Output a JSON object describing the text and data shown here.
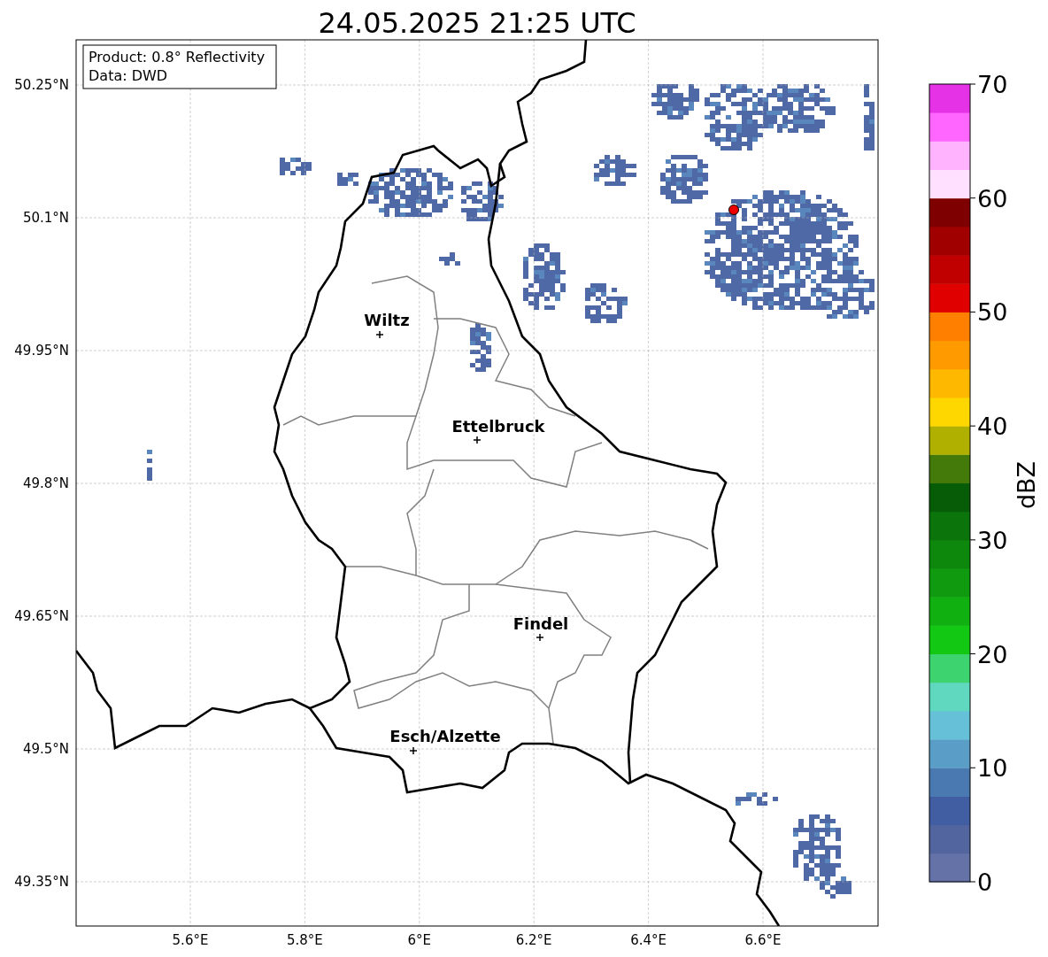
{
  "title": "24.05.2025 21:25 UTC",
  "info_box": [
    "Product: 0.8° Reflectivity",
    "Data: DWD"
  ],
  "map": {
    "lat_ticks": [
      "50.25°N",
      "50.1°N",
      "49.95°N",
      "49.8°N",
      "49.65°N",
      "49.5°N",
      "49.35°N"
    ],
    "lon_ticks": [
      "5.6°E",
      "5.8°E",
      "6°E",
      "6.2°E",
      "6.4°E",
      "6.6°E"
    ],
    "cities": [
      {
        "name": "Wiltz"
      },
      {
        "name": "Ettelbruck"
      },
      {
        "name": "Findel"
      },
      {
        "name": "Esch/Alzette"
      }
    ]
  },
  "colorbar": {
    "label": "dBZ",
    "ticks": [
      "70",
      "60",
      "50",
      "40",
      "30",
      "20",
      "10",
      "0"
    ],
    "bins": [
      {
        "color": "#6472a8"
      },
      {
        "color": "#52659e"
      },
      {
        "color": "#415ea3"
      },
      {
        "color": "#4a78b0"
      },
      {
        "color": "#5a9ec8"
      },
      {
        "color": "#65c0d8"
      },
      {
        "color": "#60d8c0"
      },
      {
        "color": "#3dd36e"
      },
      {
        "color": "#12c812"
      },
      {
        "color": "#11b011"
      },
      {
        "color": "#0f9a0f"
      },
      {
        "color": "#0d880d"
      },
      {
        "color": "#0b750b"
      },
      {
        "color": "#075c07"
      },
      {
        "color": "#437a0a"
      },
      {
        "color": "#b0b000"
      },
      {
        "color": "#ffd700"
      },
      {
        "color": "#ffb800"
      },
      {
        "color": "#ff9b00"
      },
      {
        "color": "#ff7f00"
      },
      {
        "color": "#e00000"
      },
      {
        "color": "#c00000"
      },
      {
        "color": "#a00000"
      },
      {
        "color": "#7e0000"
      },
      {
        "color": "#ffe0ff"
      },
      {
        "color": "#ffb3ff"
      },
      {
        "color": "#ff66ff"
      },
      {
        "color": "#e632e6"
      }
    ]
  }
}
